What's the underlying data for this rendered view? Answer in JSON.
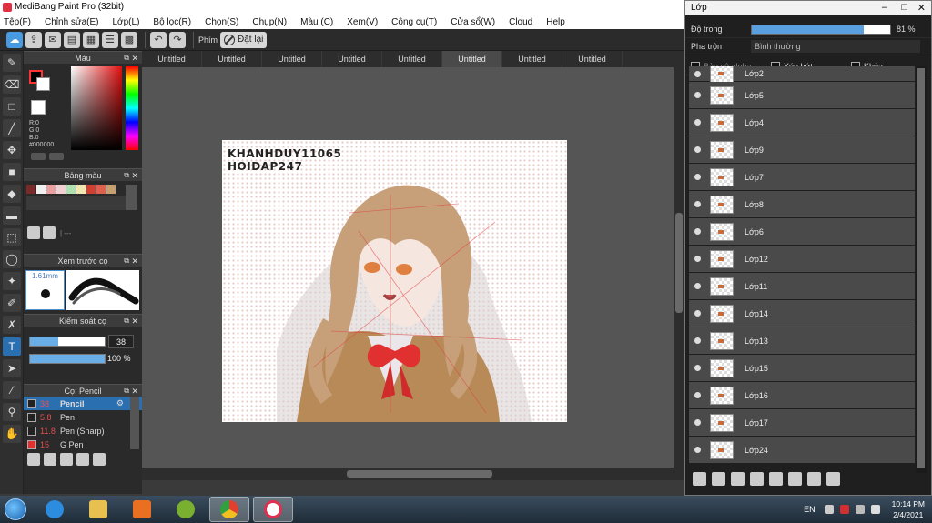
{
  "app": {
    "title": "MediBang Paint Pro (32bit)"
  },
  "menu": [
    "Tệp(F)",
    "Chỉnh sửa(E)",
    "Lớp(L)",
    "Bộ lọc(R)",
    "Chọn(S)",
    "Chụp(N)",
    "Màu (C)",
    "Xem(V)",
    "Công cụ(T)",
    "Cửa sổ(W)",
    "Cloud",
    "Help"
  ],
  "toolbar": {
    "key_label": "Phím",
    "reset_label": "Đặt lại"
  },
  "color_panel": {
    "title": "Màu",
    "r": "R:0",
    "g": "G:0",
    "b": "B:0",
    "hex": "#000000"
  },
  "palette_panel": {
    "title": "Bảng màu",
    "footer": "| ---",
    "colors": [
      "#7a2a2a",
      "#f0f0f0",
      "#e8a0a0",
      "#f0d0d0",
      "#b0e0b0",
      "#f0e8b0",
      "#d04030",
      "#e06050",
      "#c8a070"
    ]
  },
  "brush_preview": {
    "title": "Xem trước cọ",
    "size": "1.61mm"
  },
  "brush_control": {
    "title": "Kiểm soát cọ",
    "size_value": "38",
    "opacity_value": "100 %",
    "size_fill": 0.38,
    "opacity_fill": 1.0
  },
  "brush_list": {
    "title": "Cọ: Pencil",
    "items": [
      {
        "size": "38",
        "name": "Pencil"
      },
      {
        "size": "5.8",
        "name": "Pen"
      },
      {
        "size": "11.8",
        "name": "Pen (Sharp)"
      },
      {
        "size": "15",
        "name": "G Pen"
      }
    ]
  },
  "tabs": [
    "Untitled",
    "Untitled",
    "Untitled",
    "Untitled",
    "Untitled",
    "Untitled",
    "Untitled",
    "Untitled"
  ],
  "canvas": {
    "watermark1": "KHANHDUY11065",
    "watermark2": "HOIDAP247"
  },
  "layers": {
    "title": "Lớp",
    "opacity_label": "Độ trong",
    "opacity_value": "81 %",
    "opacity_fill": 0.81,
    "blend_label": "Pha trộn",
    "blend_value": "Bình thường",
    "protect_alpha": "Bảo vệ alpha",
    "clipping": "Xén bớt",
    "lock": "Khóa",
    "items": [
      "Lớp2",
      "Lớp5",
      "Lớp4",
      "Lớp9",
      "Lớp7",
      "Lớp8",
      "Lớp6",
      "Lớp12",
      "Lớp11",
      "Lớp14",
      "Lớp13",
      "Lớp15",
      "Lớp16",
      "Lớp17",
      "Lớp24"
    ]
  },
  "taskbar": {
    "lang": "EN",
    "time": "10:14 PM",
    "date": "2/4/2021"
  }
}
